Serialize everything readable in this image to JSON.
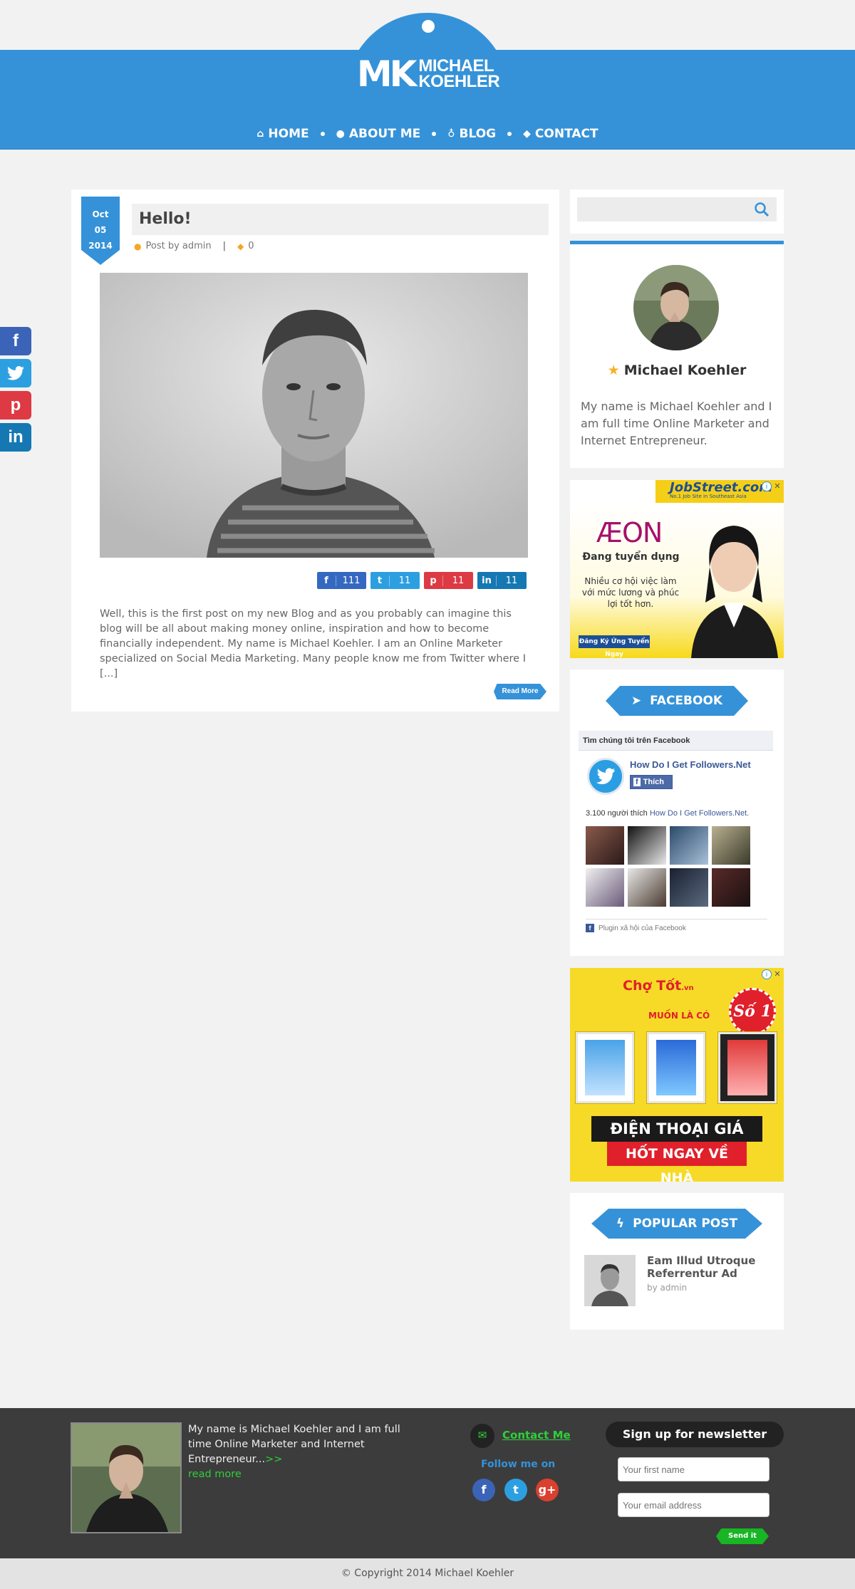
{
  "header": {
    "logo_mark": "MK",
    "logo_line1": "MICHAEL",
    "logo_line2": "KOEHLER",
    "nav": [
      {
        "label": "HOME",
        "icon": "home-icon"
      },
      {
        "label": "ABOUT ME",
        "icon": "user-icon"
      },
      {
        "label": "BLOG",
        "icon": "lightbulb-icon"
      },
      {
        "label": "CONTACT",
        "icon": "tag-icon"
      }
    ]
  },
  "social_sidebar": [
    "f",
    "t",
    "p",
    "in"
  ],
  "post": {
    "date_month": "Oct",
    "date_day": "05",
    "date_year": "2014",
    "title": "Hello!",
    "meta_author": "Post by admin",
    "meta_comments": "0",
    "shares": {
      "facebook": "111",
      "twitter": "11",
      "pinterest": "11",
      "linkedin": "11"
    },
    "excerpt": "Well, this is the first post on my new Blog and as you probably can imagine this blog will be all about making money online, inspiration and how to become financially independent. My name is Michael Koehler. I am an Online Marketer specialized on Social Media Marketing. Many people know me from Twitter where I [...]",
    "read_more": "Read More"
  },
  "sidebar": {
    "search_placeholder": "",
    "about_name": "Michael Koehler",
    "about_text": "My name is Michael Koehler and I am full time Online Marketer and Internet Entrepreneur.",
    "ad1": {
      "brand": "JobStreet.com",
      "brand_sub": "No.1 Job Site in Southeast Asia",
      "logo": "ÆON",
      "headline": "Đang tuyển dụng",
      "desc": "Nhiều cơ hội việc làm với mức lương và phúc lợi tốt hơn.",
      "button": "Đăng Ký Ứng Tuyển Ngay"
    },
    "facebook": {
      "ribbon": "FACEBOOK",
      "widget_title": "Tìm chúng tôi trên Facebook",
      "page_name": "How Do I Get Followers.Net",
      "like": "Thích",
      "count_text": "3.100 người thích",
      "count_link": "How Do I Get Followers.Net.",
      "plugin": "Plugin xã hội của Facebook"
    },
    "ad2": {
      "logo": "Chợ Tốt",
      "logo_suffix": ".vn",
      "sub": "MUỐN LÀ CÓ",
      "badge": "Số 1",
      "banner1": "ĐIỆN THOẠI GIÁ TỐT",
      "banner2": "HỐT NGAY VỀ NHÀ"
    },
    "popular": {
      "ribbon": "POPULAR POST",
      "title": "Eam Illud Utroque Referrentur Ad",
      "by": "by admin"
    }
  },
  "footer": {
    "about": "My name is Michael Koehler and I am full time Online Marketer and Internet Entrepreneur...",
    "more_arrow": ">>",
    "more": "read more",
    "contact": "Contact Me",
    "follow": "Follow me on",
    "newsletter_title": "Sign up for newsletter",
    "first_name_placeholder": "Your first name",
    "email_placeholder": "Your email address",
    "send": "Send it",
    "copyright": "© Copyright 2014 Michael Koehler"
  },
  "colors": {
    "primary": "#3592d8",
    "footer": "#3c3c3c",
    "accent_green": "#2fcf3a"
  }
}
